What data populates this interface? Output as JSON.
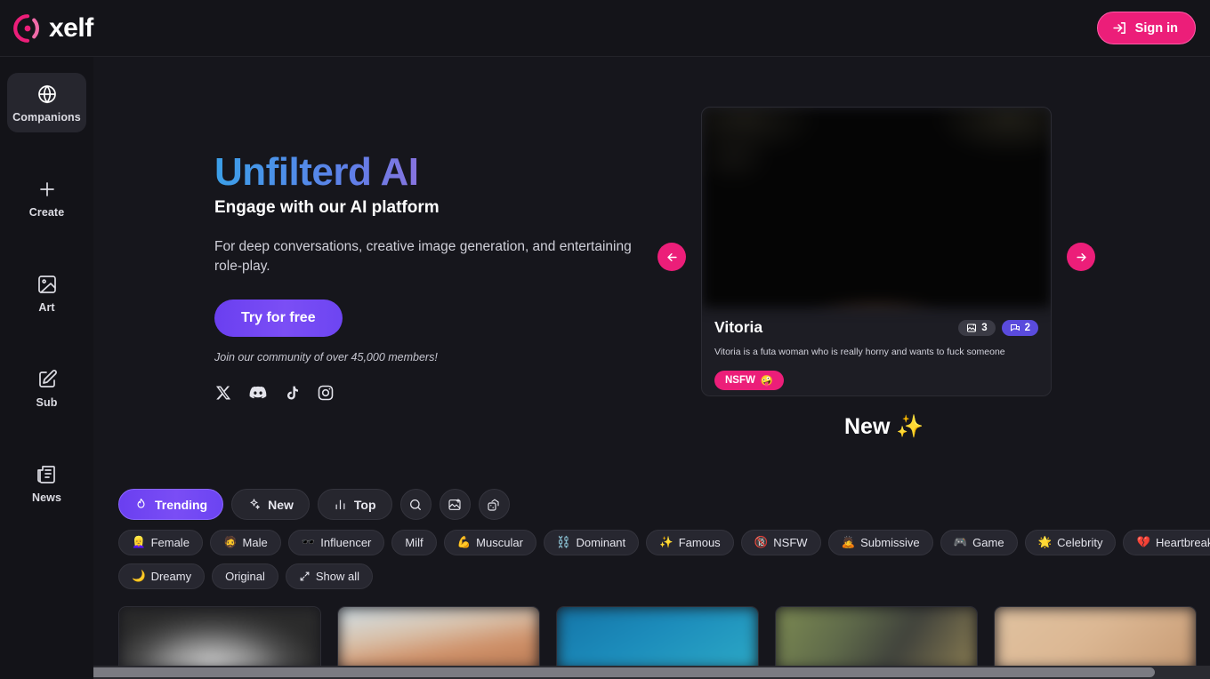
{
  "brand": {
    "name": "xelf",
    "logo_icon": "xelf-logo-icon",
    "accent": "#ec1e79"
  },
  "topbar": {
    "signin_label": "Sign in",
    "signin_icon": "sign-in-arrow-icon"
  },
  "sidebar": {
    "items": [
      {
        "label": "Companions",
        "icon": "globe-icon",
        "active": true
      },
      {
        "label": "Create",
        "icon": "plus-icon",
        "active": false
      },
      {
        "label": "Art",
        "icon": "image-icon",
        "active": false
      },
      {
        "label": "Sub",
        "icon": "edit-pencil-icon",
        "active": false
      },
      {
        "label": "News",
        "icon": "newspaper-icon",
        "active": false
      }
    ]
  },
  "hero": {
    "title": "Unfilterd AI",
    "subtitle": "Engage with our AI platform",
    "description": "For deep conversations, creative image generation, and entertaining role-play.",
    "cta_label": "Try for free",
    "community_note": "Join our community of over 45,000 members!",
    "socials": [
      {
        "name": "x-twitter-icon"
      },
      {
        "name": "discord-icon"
      },
      {
        "name": "tiktok-icon"
      },
      {
        "name": "instagram-icon"
      }
    ],
    "title_gradient": [
      "#3b9fe8",
      "#a06cd8",
      "#ef77ab"
    ]
  },
  "carousel": {
    "prev_icon": "arrow-left-icon",
    "next_icon": "arrow-right-icon",
    "featured": {
      "name": "Vitoria",
      "description": "Vitoria is a futa woman who is really horny and wants to fuck someone",
      "image_count": "3",
      "chat_count": "2",
      "image_badge_icon": "image-stack-icon",
      "chat_badge_icon": "chat-bubble-icon",
      "nsfw_label": "NSFW",
      "nsfw_emoji": "🤪"
    }
  },
  "section": {
    "new_heading": "New",
    "new_emoji": "✨"
  },
  "filters": {
    "main": [
      {
        "label": "Trending",
        "icon": "flame-icon",
        "active": true
      },
      {
        "label": "New",
        "icon": "sparkles-icon",
        "active": false
      },
      {
        "label": "Top",
        "icon": "bar-chart-icon",
        "active": false
      },
      {
        "label": "",
        "icon": "search-icon",
        "active": false
      },
      {
        "label": "",
        "icon": "image-plus-icon",
        "active": false
      },
      {
        "label": "",
        "icon": "dice-shuffle-icon",
        "active": false
      }
    ],
    "tags_row1": [
      {
        "label": "Female",
        "emoji": "👱‍♀️"
      },
      {
        "label": "Male",
        "emoji": "🧔"
      },
      {
        "label": "Influencer",
        "emoji": "🕶️"
      },
      {
        "label": "Milf",
        "emoji": ""
      },
      {
        "label": "Muscular",
        "emoji": "💪"
      },
      {
        "label": "Dominant",
        "emoji": "⛓️"
      },
      {
        "label": "Famous",
        "emoji": "✨"
      },
      {
        "label": "NSFW",
        "emoji": "🔞"
      },
      {
        "label": "Submissive",
        "emoji": "🙇"
      },
      {
        "label": "Game",
        "emoji": "🎮"
      },
      {
        "label": "Celebrity",
        "emoji": "🌟"
      },
      {
        "label": "Heartbreak",
        "emoji": "💔"
      }
    ],
    "tags_row2": [
      {
        "label": "Dreamy",
        "emoji": "🌙"
      },
      {
        "label": "Original",
        "emoji": ""
      },
      {
        "label": "Show all",
        "emoji": "",
        "icon": "expand-arrows-icon"
      }
    ]
  },
  "grid": {
    "cards": [
      {
        "tone": "g1"
      },
      {
        "tone": "g2"
      },
      {
        "tone": "g3"
      },
      {
        "tone": "g4"
      },
      {
        "tone": "g5"
      }
    ]
  }
}
